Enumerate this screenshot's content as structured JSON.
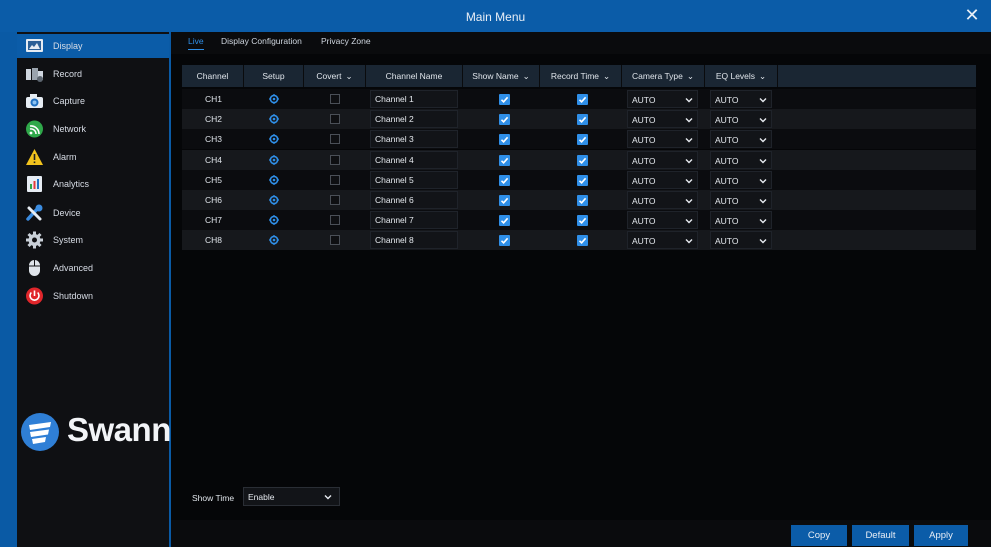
{
  "window": {
    "title": "Main Menu"
  },
  "sidebar": {
    "items": [
      {
        "label": "Display",
        "icon": "display-icon"
      },
      {
        "label": "Record",
        "icon": "record-icon"
      },
      {
        "label": "Capture",
        "icon": "camera-icon"
      },
      {
        "label": "Network",
        "icon": "network-icon"
      },
      {
        "label": "Alarm",
        "icon": "alarm-icon"
      },
      {
        "label": "Analytics",
        "icon": "analytics-icon"
      },
      {
        "label": "Device",
        "icon": "device-icon"
      },
      {
        "label": "System",
        "icon": "gear-icon"
      },
      {
        "label": "Advanced",
        "icon": "mouse-icon"
      },
      {
        "label": "Shutdown",
        "icon": "power-icon"
      }
    ],
    "active": "Display",
    "logo": "Swann"
  },
  "tabs": [
    "Live",
    "Display Configuration",
    "Privacy Zone"
  ],
  "active_tab": "Live",
  "table": {
    "headers": [
      "Channel",
      "Setup",
      "Covert",
      "Channel Name",
      "Show Name",
      "Record Time",
      "Camera Type",
      "EQ Levels"
    ],
    "rows": [
      {
        "channel": "CH1",
        "name": "Channel 1",
        "covert": false,
        "show_name": true,
        "record_time": true,
        "camera_type": "AUTO",
        "eq_levels": "AUTO"
      },
      {
        "channel": "CH2",
        "name": "Channel 2",
        "covert": false,
        "show_name": true,
        "record_time": true,
        "camera_type": "AUTO",
        "eq_levels": "AUTO"
      },
      {
        "channel": "CH3",
        "name": "Channel 3",
        "covert": false,
        "show_name": true,
        "record_time": true,
        "camera_type": "AUTO",
        "eq_levels": "AUTO"
      },
      {
        "channel": "CH4",
        "name": "Channel 4",
        "covert": false,
        "show_name": true,
        "record_time": true,
        "camera_type": "AUTO",
        "eq_levels": "AUTO"
      },
      {
        "channel": "CH5",
        "name": "Channel 5",
        "covert": false,
        "show_name": true,
        "record_time": true,
        "camera_type": "AUTO",
        "eq_levels": "AUTO"
      },
      {
        "channel": "CH6",
        "name": "Channel 6",
        "covert": false,
        "show_name": true,
        "record_time": true,
        "camera_type": "AUTO",
        "eq_levels": "AUTO"
      },
      {
        "channel": "CH7",
        "name": "Channel 7",
        "covert": false,
        "show_name": true,
        "record_time": true,
        "camera_type": "AUTO",
        "eq_levels": "AUTO"
      },
      {
        "channel": "CH8",
        "name": "Channel 8",
        "covert": false,
        "show_name": true,
        "record_time": true,
        "camera_type": "AUTO",
        "eq_levels": "AUTO"
      }
    ]
  },
  "show_time": {
    "label": "Show Time",
    "value": "Enable"
  },
  "buttons": {
    "copy": "Copy",
    "default": "Default",
    "apply": "Apply"
  },
  "colors": {
    "accent": "#0b5ca8",
    "check": "#2f8fe8",
    "background": "#050608",
    "sidebar": "#0f1013"
  }
}
